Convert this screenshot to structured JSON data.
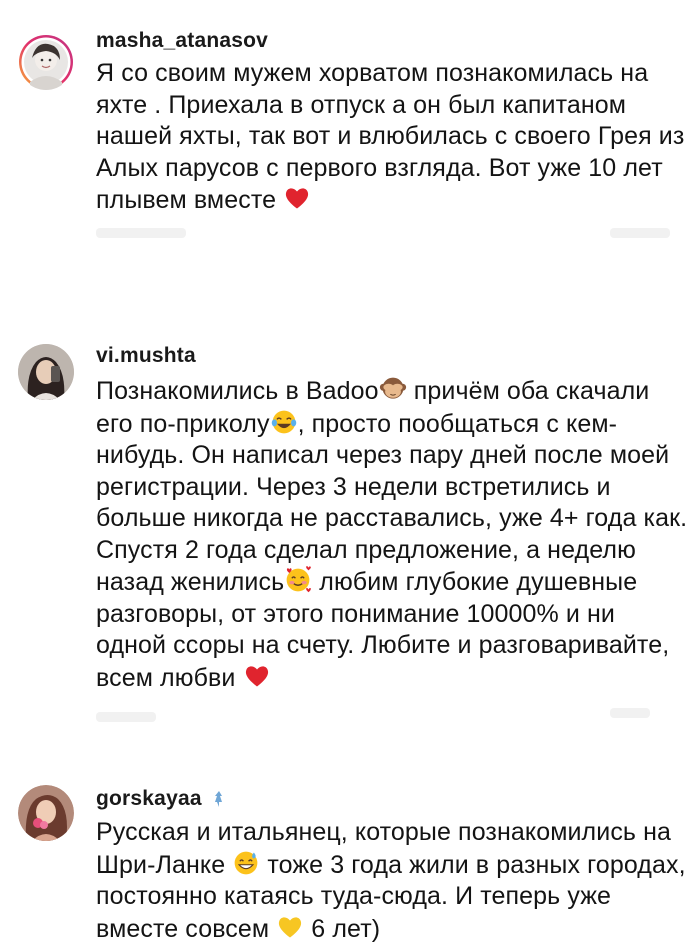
{
  "comments": [
    {
      "username": "masha_atanasov",
      "avatar_icon": "avatar-photo-icon",
      "text_parts": [
        "Я со своим  мужем хорватом познакомилась на яхте . Приехала в отпуск а он был капитаном нашей яхты, так вот и влюбилась с своего Грея из Алых парусов с первого взгляда.  Вот уже 10 лет плывем вместе "
      ],
      "emojis": [
        "red-heart-icon"
      ]
    },
    {
      "username": "vi.mushta",
      "avatar_icon": "avatar-photo-icon",
      "text_parts": [
        "Познакомились в Badoo",
        " причём оба скачали его по-приколу",
        ", просто пообщаться с кем-нибудь. Он написал через пару дней после моей регистрации. Через 3 недели встретились и больше никогда не расставались, уже 4+ года как. Спустя 2 года сделал предложение, а неделю назад женились",
        " любим глубокие душевные разговоры, от этого понимание 10000% и ни одной ссоры на счету. Любите и разговаривайте, всем любви "
      ],
      "emojis": [
        "see-no-evil-monkey-icon",
        "tears-of-joy-icon",
        "smiling-face-with-hearts-icon",
        "red-heart-icon"
      ]
    },
    {
      "username": "gorskayaa",
      "avatar_icon": "avatar-photo-icon",
      "verified": true,
      "text_parts": [
        "Русская и итальянец, которые познакомились на Шри-Ланке ",
        " тоже 3 года жили в разных городах, постоянно катаясь туда-сюда. И теперь уже вместе совсем ",
        " 6 лет)"
      ],
      "emojis": [
        "grinning-sweat-icon",
        "yellow-heart-icon"
      ]
    }
  ],
  "colors": {
    "story_ring_start": "#f9b233",
    "story_ring_mid": "#e1306c",
    "story_ring_end": "#c13584",
    "heart_red": "#e0242e",
    "heart_yellow": "#f7c623",
    "emoji_yellow": "#fcc21b"
  }
}
